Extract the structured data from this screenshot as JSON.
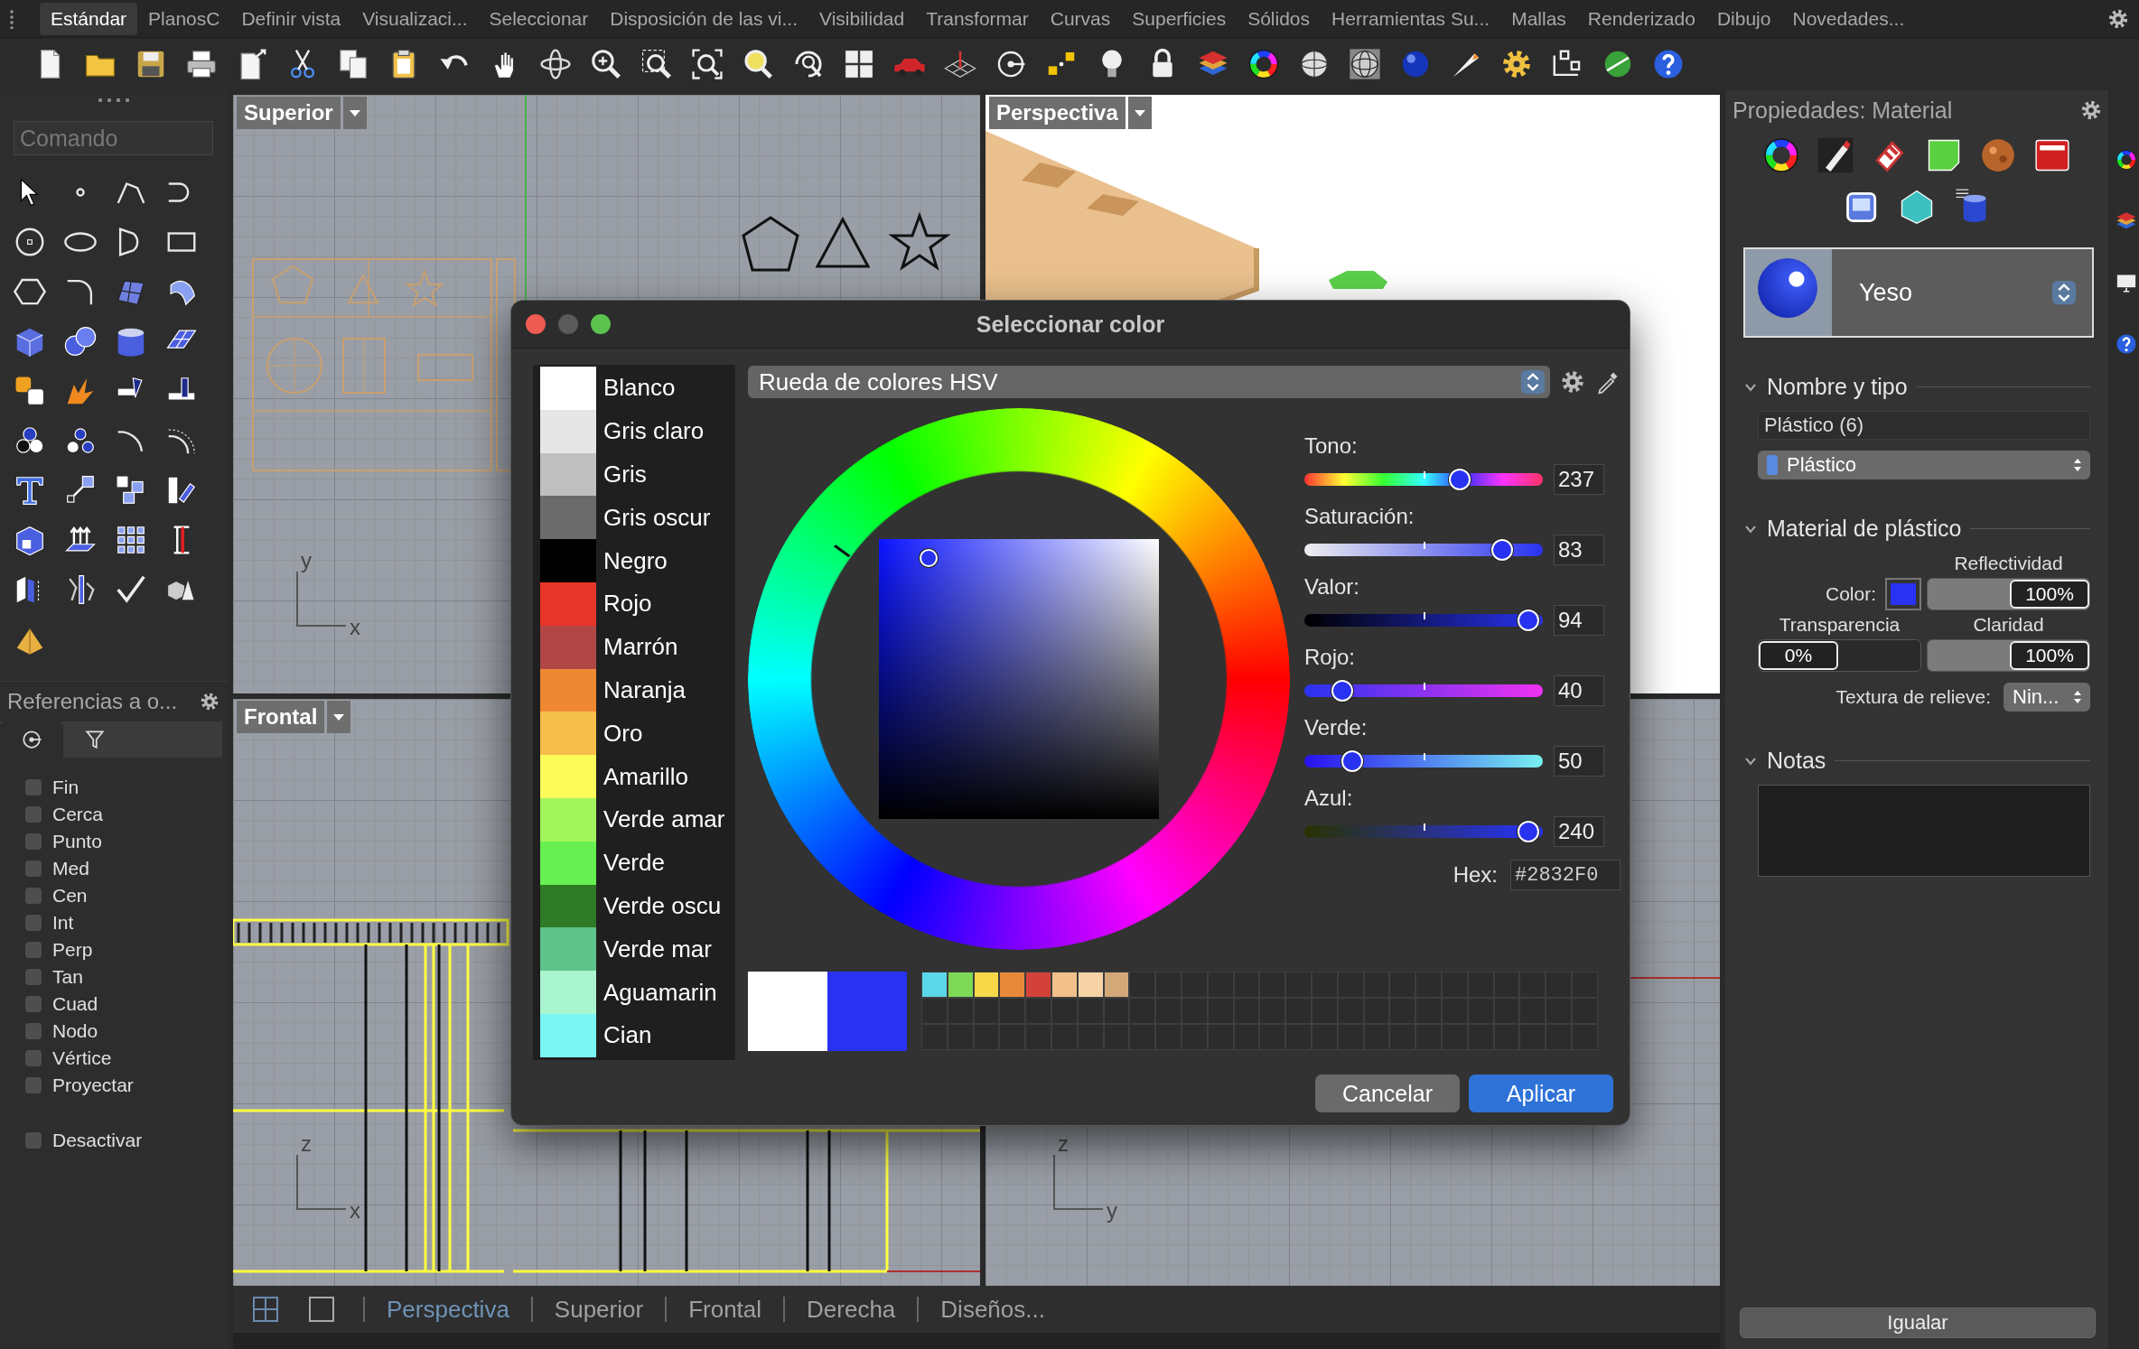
{
  "menu_tabs": [
    {
      "label": "Estándar",
      "selected": true
    },
    {
      "label": "PlanosC",
      "selected": false
    },
    {
      "label": "Definir vista",
      "selected": false
    },
    {
      "label": "Visualizaci...",
      "selected": false
    },
    {
      "label": "Seleccionar",
      "selected": false
    },
    {
      "label": "Disposición de las vi...",
      "selected": false
    },
    {
      "label": "Visibilidad",
      "selected": false
    },
    {
      "label": "Transformar",
      "selected": false
    },
    {
      "label": "Curvas",
      "selected": false
    },
    {
      "label": "Superficies",
      "selected": false
    },
    {
      "label": "Sólidos",
      "selected": false
    },
    {
      "label": "Herramientas Su...",
      "selected": false
    },
    {
      "label": "Mallas",
      "selected": false
    },
    {
      "label": "Renderizado",
      "selected": false
    },
    {
      "label": "Dibujo",
      "selected": false
    },
    {
      "label": "Novedades...",
      "selected": false
    }
  ],
  "sidebar": {
    "command": {
      "placeholder": "Comando"
    },
    "osnap_title": "Referencias a o...",
    "osnap_tabs": [
      {
        "selected": true
      },
      {
        "selected": false
      }
    ],
    "osnaps": [
      {
        "label": "Fin",
        "checked": false
      },
      {
        "label": "Cerca",
        "checked": false
      },
      {
        "label": "Punto",
        "checked": false
      },
      {
        "label": "Med",
        "checked": false
      },
      {
        "label": "Cen",
        "checked": false
      },
      {
        "label": "Int",
        "checked": false
      },
      {
        "label": "Perp",
        "checked": false
      },
      {
        "label": "Tan",
        "checked": false
      },
      {
        "label": "Cuad",
        "checked": false
      },
      {
        "label": "Nodo",
        "checked": false
      },
      {
        "label": "Vértice",
        "checked": false
      },
      {
        "label": "Proyectar",
        "checked": false
      },
      {
        "label": "Desactivar",
        "checked": false,
        "kind": "separated"
      }
    ]
  },
  "viewports": [
    {
      "kind": "top",
      "title": "Superior",
      "axes": [
        "y",
        "x"
      ]
    },
    {
      "kind": "perspective",
      "title": "Perspectiva"
    },
    {
      "kind": "front",
      "title": "Frontal",
      "axes": [
        "z",
        "x"
      ]
    },
    {
      "kind": "right",
      "axes": [
        "z",
        "y"
      ]
    }
  ],
  "viewport_tabs": [
    {
      "label": "Perspectiva",
      "selected": true
    },
    {
      "label": "Superior",
      "selected": false
    },
    {
      "label": "Frontal",
      "selected": false
    },
    {
      "label": "Derecha",
      "selected": false
    },
    {
      "label": "Diseños...",
      "selected": false
    }
  ],
  "dialog": {
    "title": "Seleccionar color",
    "colors": [
      {
        "label": "Blanco",
        "color": "#ffffff"
      },
      {
        "label": "Gris claro",
        "color": "#e6e6e6"
      },
      {
        "label": "Gris",
        "color": "#bfbfbf"
      },
      {
        "label": "Gris oscur",
        "color": "#6b6b6b"
      },
      {
        "label": "Negro",
        "color": "#000000"
      },
      {
        "label": "Rojo",
        "color": "#e8352a"
      },
      {
        "label": "Marrón",
        "color": "#b04646"
      },
      {
        "label": "Naranja",
        "color": "#ef8833"
      },
      {
        "label": "Oro",
        "color": "#f5bf4a"
      },
      {
        "label": "Amarillo",
        "color": "#fbfb5a"
      },
      {
        "label": "Verde amar",
        "color": "#a2f55a"
      },
      {
        "label": "Verde",
        "color": "#66f052"
      },
      {
        "label": "Verde oscu",
        "color": "#2f7a24"
      },
      {
        "label": "Verde mar",
        "color": "#5fc28a"
      },
      {
        "label": "Aguamarin",
        "color": "#a8f5cf"
      },
      {
        "label": "Cian",
        "color": "#7cf5f5"
      }
    ],
    "mode": "Rueda de colores HSV",
    "sliders": [
      {
        "kind": "hue",
        "label": "Tono:",
        "value": "237",
        "level": 0.65
      },
      {
        "kind": "saturation",
        "label": "Saturación:",
        "value": "83",
        "level": 0.83
      },
      {
        "kind": "value",
        "label": "Valor:",
        "value": "94",
        "level": 0.94
      },
      {
        "kind": "red",
        "label": "Rojo:",
        "value": "40",
        "level": 0.16
      },
      {
        "kind": "green",
        "label": "Verde:",
        "value": "50",
        "level": 0.2
      },
      {
        "kind": "blue",
        "label": "Azul:",
        "value": "240",
        "level": 0.94
      }
    ],
    "hex_label": "Hex:",
    "hex": "#2832F0",
    "custom_swatches": [
      {
        "color": "#5ad7e9"
      },
      {
        "color": "#7ed957"
      },
      {
        "color": "#f7d849"
      },
      {
        "color": "#e8893a"
      },
      {
        "color": "#d2423a"
      },
      {
        "color": "#f2c08a"
      },
      {
        "color": "#f5d3a6"
      },
      {
        "color": "#d4a97a"
      }
    ],
    "buttons": [
      {
        "label": "Cancelar",
        "kind": "secondary"
      },
      {
        "label": "Aplicar",
        "kind": "primary"
      }
    ]
  },
  "properties": {
    "title": "Propiedades: Material",
    "material": "Yeso",
    "name_section": {
      "title": "Nombre y tipo",
      "expanded": true,
      "name": "Plástico (6)",
      "type": "Plástico"
    },
    "plastic_section": {
      "title": "Material de plástico",
      "expanded": true,
      "color_label": "Color:",
      "color": "#2832f0",
      "reflectivity": {
        "label": "Reflectividad",
        "value": "100%",
        "level": 1
      },
      "transparency": {
        "label": "Transparencia",
        "value": "0%",
        "level": 0
      },
      "clarity": {
        "label": "Claridad",
        "value": "100%",
        "level": 1
      },
      "bump_label": "Textura de relieve:",
      "bump": "Nin..."
    },
    "notes_section": {
      "title": "Notas",
      "expanded": true
    },
    "match_button": "Igualar"
  }
}
